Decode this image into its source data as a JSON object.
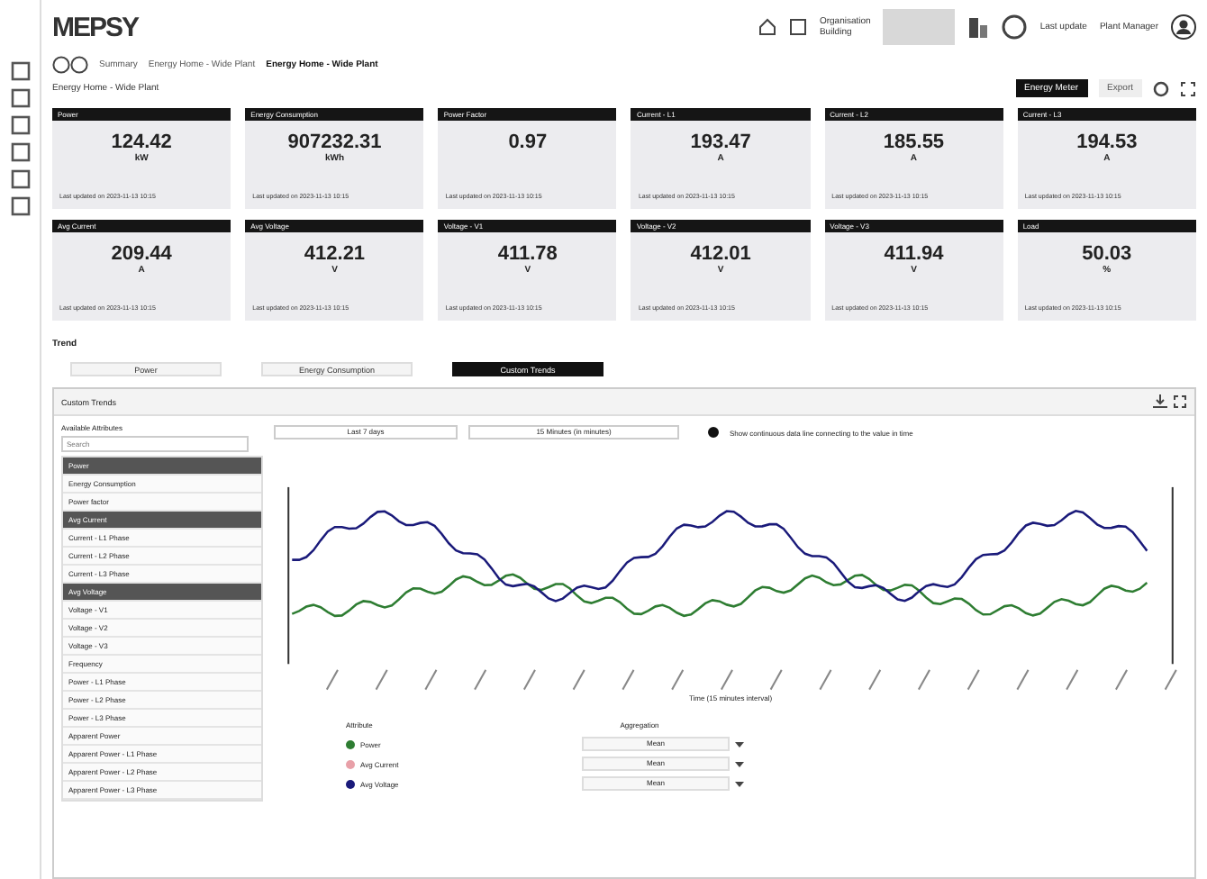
{
  "header": {
    "logo": "MEPSY",
    "org_label": "Organisation",
    "site": "Building",
    "date_label": "Last update",
    "user": "Plant Manager"
  },
  "breadcrumb": [
    "Summary",
    "Energy Home - Wide Plant",
    "Energy Home - Wide Plant"
  ],
  "page_title": "Energy Home - Wide Plant",
  "toolbar": {
    "primary_button": "Energy Meter",
    "secondary_button": "Export"
  },
  "cards": [
    {
      "title": "Power",
      "value": "124.42",
      "unit": "kW",
      "updated": "Last updated on 2023-11-13 10:15"
    },
    {
      "title": "Energy Consumption",
      "value": "907232.31",
      "unit": "kWh",
      "updated": "Last updated on 2023-11-13 10:15"
    },
    {
      "title": "Power Factor",
      "value": "0.97",
      "updated": "Last updated on 2023-11-13 10:15"
    },
    {
      "title": "Current - L1",
      "value": "193.47",
      "unit": "A",
      "updated": "Last updated on 2023-11-13 10:15"
    },
    {
      "title": "Current - L2",
      "value": "185.55",
      "unit": "A",
      "updated": "Last updated on 2023-11-13 10:15"
    },
    {
      "title": "Current - L3",
      "value": "194.53",
      "unit": "A",
      "updated": "Last updated on 2023-11-13 10:15"
    },
    {
      "title": "Avg Current",
      "value": "209.44",
      "unit": "A",
      "updated": "Last updated on 2023-11-13 10:15"
    },
    {
      "title": "Avg Voltage",
      "value": "412.21",
      "unit": "V",
      "updated": "Last updated on 2023-11-13 10:15"
    },
    {
      "title": "Voltage - V1",
      "value": "411.78",
      "unit": "V",
      "updated": "Last updated on 2023-11-13 10:15"
    },
    {
      "title": "Voltage - V2",
      "value": "412.01",
      "unit": "V",
      "updated": "Last updated on 2023-11-13 10:15"
    },
    {
      "title": "Voltage - V3",
      "value": "411.94",
      "unit": "V",
      "updated": "Last updated on 2023-11-13 10:15"
    },
    {
      "title": "Load",
      "value": "50.03",
      "unit": "%",
      "updated": "Last updated on 2023-11-13 10:15"
    }
  ],
  "trend_label": "Trend",
  "tabs": [
    {
      "label": "Power",
      "selected": false
    },
    {
      "label": "Energy Consumption",
      "selected": false
    },
    {
      "label": "Custom Trends",
      "selected": true
    }
  ],
  "panel": {
    "title": "Custom Trends",
    "list_title": "Available Attributes",
    "search_placeholder": "Search",
    "items": [
      {
        "label": "Power",
        "kind": "header"
      },
      {
        "label": "Energy Consumption",
        "kind": "item"
      },
      {
        "label": "Power factor",
        "kind": "item"
      },
      {
        "label": "Avg Current",
        "kind": "header"
      },
      {
        "label": "Current - L1 Phase",
        "kind": "item"
      },
      {
        "label": "Current - L2 Phase",
        "kind": "item"
      },
      {
        "label": "Current - L3 Phase",
        "kind": "item"
      },
      {
        "label": "Avg Voltage",
        "kind": "header"
      },
      {
        "label": "Voltage - V1",
        "kind": "item"
      },
      {
        "label": "Voltage - V2",
        "kind": "item"
      },
      {
        "label": "Voltage - V3",
        "kind": "item"
      },
      {
        "label": "Frequency",
        "kind": "item"
      },
      {
        "label": "Power - L1 Phase",
        "kind": "item"
      },
      {
        "label": "Power - L2 Phase",
        "kind": "item"
      },
      {
        "label": "Power - L3 Phase",
        "kind": "item"
      },
      {
        "label": "Apparent Power",
        "kind": "item"
      },
      {
        "label": "Apparent Power - L1 Phase",
        "kind": "item"
      },
      {
        "label": "Apparent Power - L2 Phase",
        "kind": "item"
      },
      {
        "label": "Apparent Power - L3 Phase",
        "kind": "item"
      }
    ],
    "range_from": "Last 7 days",
    "range_interval": "15 Minutes (in minutes)",
    "option_checked": true,
    "option_label": "Show continuous data line connecting to the value in time",
    "x_title": "Time (15 minutes interval)",
    "legend_title": "Attribute",
    "agg_title": "Aggregation",
    "series": [
      {
        "name": "Power",
        "color": "#2e7d32",
        "agg": "Mean"
      },
      {
        "name": "Avg Current",
        "color": "#e8a0a8",
        "agg": "Mean"
      },
      {
        "name": "Avg Voltage",
        "color": "#1a1a7a",
        "agg": "Mean"
      }
    ]
  }
}
